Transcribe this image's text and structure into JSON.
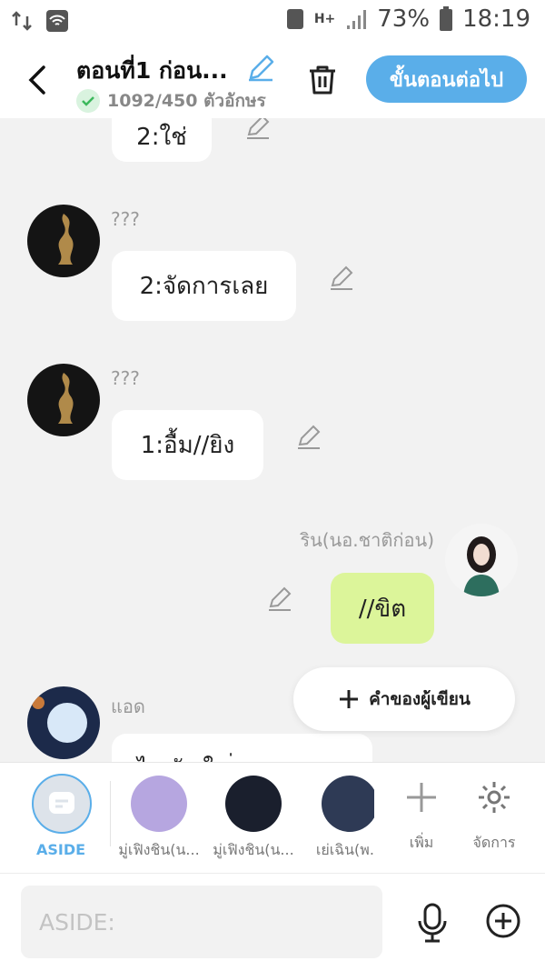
{
  "status_bar": {
    "battery": "73%",
    "time": "18:19",
    "network": "H+"
  },
  "header": {
    "title": "ตอนที่1 ก่อน...",
    "char_count": "1092/450 ตัวอักษร",
    "next_label": "ขั้นตอนต่อไป"
  },
  "messages": [
    {
      "text": "2:ใช่"
    },
    {
      "sender": "???",
      "text": "2:จัดการเลย"
    },
    {
      "sender": "???",
      "text": "1:อื้ม//ยิง"
    },
    {
      "sender": "ริน(นอ.ชาติก่อน)",
      "text": "//ขิต"
    },
    {
      "sender": "แอด",
      "text": "ไ...สั...ใ...่"
    }
  ],
  "fab": {
    "label": "คำของผู้เขียน"
  },
  "characters": [
    {
      "label": "ASIDE"
    },
    {
      "label": "มู่เฟิงชิน(น..."
    },
    {
      "label": "มู่เฟิงชิน(น..."
    },
    {
      "label": "เย่เฉิน(พ..."
    }
  ],
  "actions": {
    "add_label": "เพิ่ม",
    "manage_label": "จัดการ"
  },
  "composer": {
    "placeholder": "ASIDE:"
  },
  "colors": {
    "accent": "#5aaee9",
    "green_bubble": "#dcf59a",
    "background": "#f2f2f2"
  }
}
